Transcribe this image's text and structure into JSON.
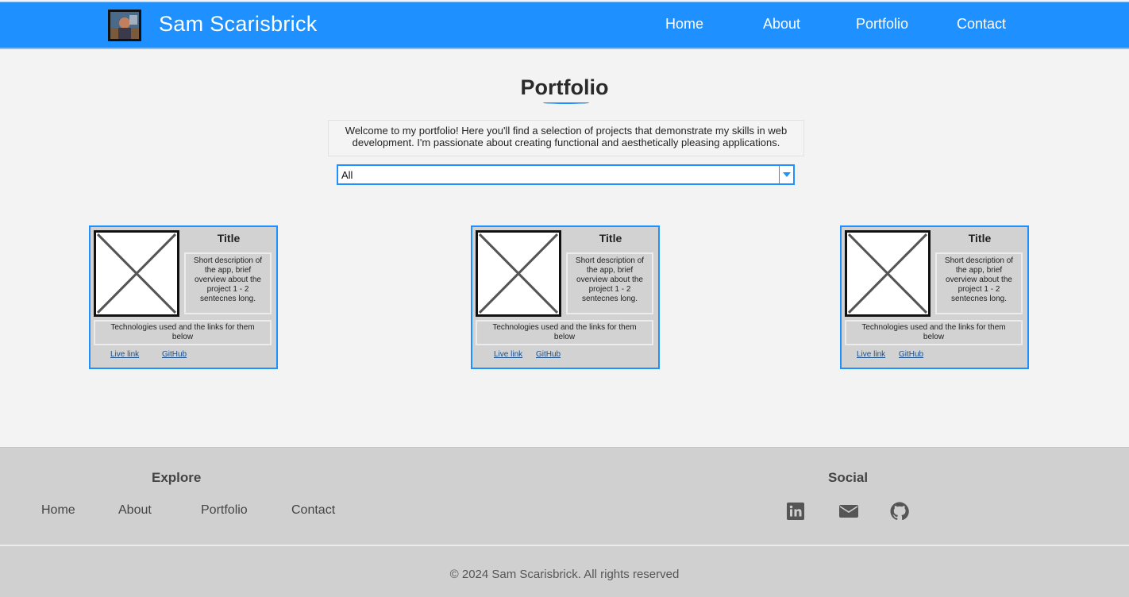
{
  "header": {
    "brand": "Sam Scarisbrick",
    "avatar_icon": "profile-photo",
    "nav": [
      "Home",
      "About",
      "Portfolio",
      "Contact"
    ]
  },
  "main": {
    "title": "Portfolio",
    "intro": "Welcome to my portfolio! Here you'll find a selection of projects that demonstrate my skills in web development. I'm passionate about creating functional and aesthetically pleasing applications.",
    "filter": {
      "selected": "All"
    },
    "cards": [
      {
        "title": "Title",
        "description": "Short description of the app, brief overview about the project 1 - 2 sentecnes long.",
        "technologies": "Technologies used and the links for them below",
        "live_link": "Live link",
        "github_link": "GitHub"
      },
      {
        "title": "Title",
        "description": "Short description of the app, brief overview about the project 1 - 2 sentecnes long.",
        "technologies": "Technologies used and the links for them below",
        "live_link": "Live link",
        "github_link": "GitHub"
      },
      {
        "title": "Title",
        "description": "Short description of the app, brief overview about the project 1 - 2 sentecnes long.",
        "technologies": "Technologies used and the links for them below",
        "live_link": "Live link",
        "github_link": "GitHub"
      }
    ]
  },
  "footer": {
    "explore_heading": "Explore",
    "explore_links": [
      "Home",
      "About",
      "Portfolio",
      "Contact"
    ],
    "social_heading": "Social",
    "social_icons": [
      "linkedin-icon",
      "email-icon",
      "github-icon"
    ],
    "copyright": "© 2024 Sam Scarisbrick. All rights reserved"
  },
  "colors": {
    "accent": "#1e90ff",
    "header_bg": "#1e90ff",
    "footer_bg": "#d0d0d0",
    "card_bg": "#d2d2d2",
    "page_bg": "#f3f3f3"
  }
}
